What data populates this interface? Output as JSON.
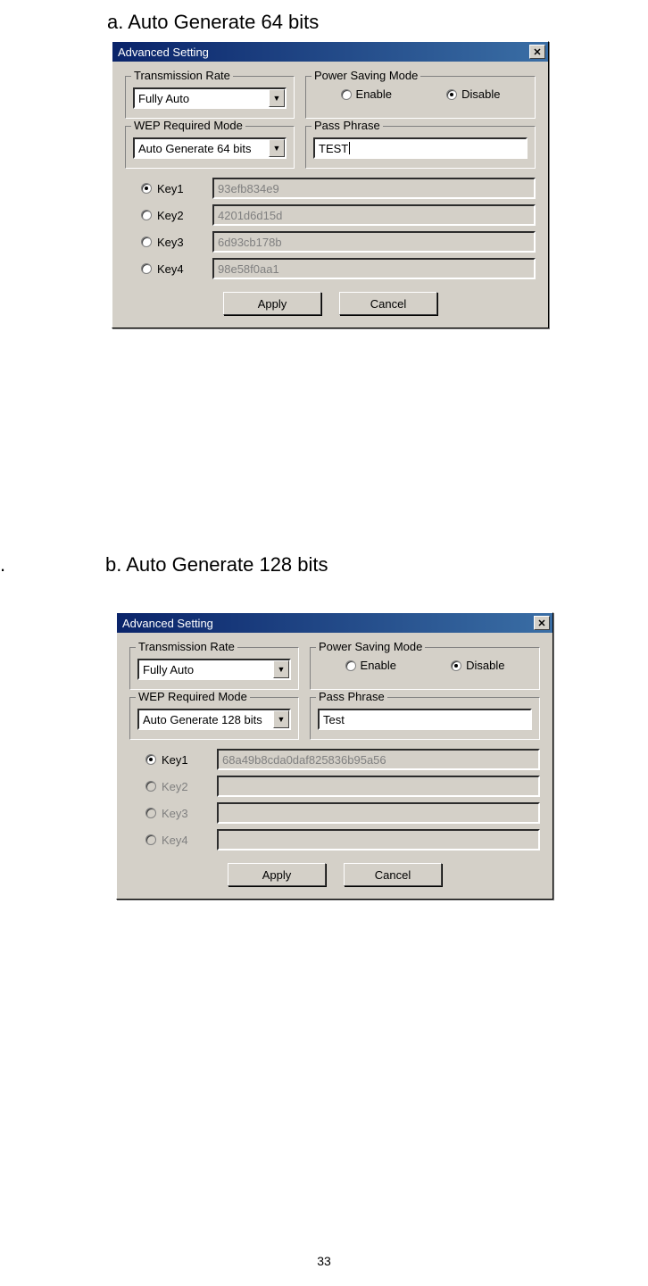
{
  "doc": {
    "label_a": "a. Auto Generate 64 bits",
    "label_b": "b. Auto Generate 128 bits",
    "bullet": ".",
    "page_number": "33"
  },
  "dialog_a": {
    "title": "Advanced Setting",
    "close": "✕",
    "transmission_rate": {
      "legend": "Transmission Rate",
      "value": "Fully Auto"
    },
    "power_saving": {
      "legend": "Power Saving Mode",
      "enable": "Enable",
      "disable": "Disable",
      "selected": "disable"
    },
    "wep_mode": {
      "legend": "WEP Required Mode",
      "value": "Auto Generate 64 bits"
    },
    "pass_phrase": {
      "legend": "Pass Phrase",
      "value": "TEST"
    },
    "keys": [
      {
        "label": "Key1",
        "value": "93efb834e9",
        "selected": true,
        "disabled": false
      },
      {
        "label": "Key2",
        "value": "4201d6d15d",
        "selected": false,
        "disabled": false
      },
      {
        "label": "Key3",
        "value": "6d93cb178b",
        "selected": false,
        "disabled": false
      },
      {
        "label": "Key4",
        "value": "98e58f0aa1",
        "selected": false,
        "disabled": false
      }
    ],
    "buttons": {
      "apply": "Apply",
      "cancel": "Cancel"
    }
  },
  "dialog_b": {
    "title": "Advanced Setting",
    "close": "✕",
    "transmission_rate": {
      "legend": "Transmission Rate",
      "value": "Fully Auto"
    },
    "power_saving": {
      "legend": "Power Saving Mode",
      "enable": "Enable",
      "disable": "Disable",
      "selected": "disable"
    },
    "wep_mode": {
      "legend": "WEP Required Mode",
      "value": "Auto Generate 128 bits"
    },
    "pass_phrase": {
      "legend": "Pass Phrase",
      "value": "Test"
    },
    "keys": [
      {
        "label": "Key1",
        "value": "68a49b8cda0daf825836b95a56",
        "selected": true,
        "disabled": false
      },
      {
        "label": "Key2",
        "value": "",
        "selected": false,
        "disabled": true
      },
      {
        "label": "Key3",
        "value": "",
        "selected": false,
        "disabled": true
      },
      {
        "label": "Key4",
        "value": "",
        "selected": false,
        "disabled": true
      }
    ],
    "buttons": {
      "apply": "Apply",
      "cancel": "Cancel"
    }
  }
}
